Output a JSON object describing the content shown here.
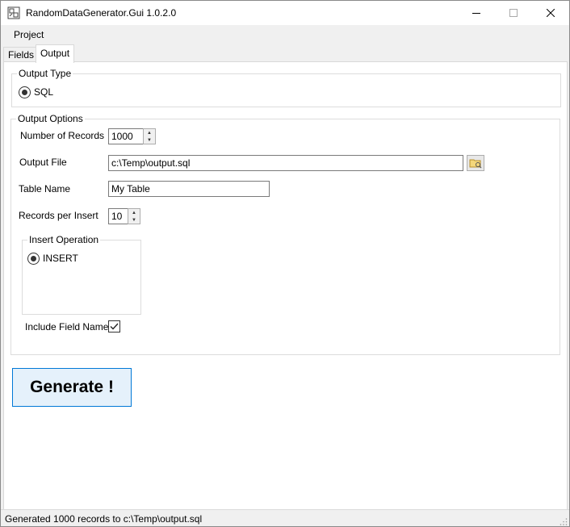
{
  "window": {
    "title": "RandomDataGenerator.Gui 1.0.2.0",
    "minimize_icon": "minimize-icon",
    "maximize_icon": "maximize-icon",
    "close_icon": "close-icon"
  },
  "menu": {
    "items": [
      {
        "label": "Project"
      }
    ]
  },
  "tabs": [
    {
      "label": "Fields",
      "selected": false
    },
    {
      "label": "Output",
      "selected": true
    }
  ],
  "output_type": {
    "title": "Output Type",
    "option_label": "SQL",
    "selected": true
  },
  "output_options": {
    "title": "Output Options",
    "number_of_records": {
      "label": "Number of Records",
      "value": "1000"
    },
    "output_file": {
      "label": "Output File",
      "value": "c:\\Temp\\output.sql",
      "browse_icon": "folder-browse-icon"
    },
    "table_name": {
      "label": "Table Name",
      "value": "My Table"
    },
    "records_per_insert": {
      "label": "Records per Insert",
      "value": "10"
    },
    "insert_operation": {
      "title": "Insert Operation",
      "option_label": "INSERT",
      "selected": true
    },
    "include_field_names": {
      "label": "Include Field Names",
      "checked": true
    }
  },
  "generate_button": {
    "label": "Generate !"
  },
  "status": {
    "text": "Generated 1000 records to c:\\Temp\\output.sql"
  },
  "colors": {
    "generate_border": "#0078d7",
    "generate_bg": "#e5f1fb",
    "window_bg": "#f0f0f0"
  }
}
